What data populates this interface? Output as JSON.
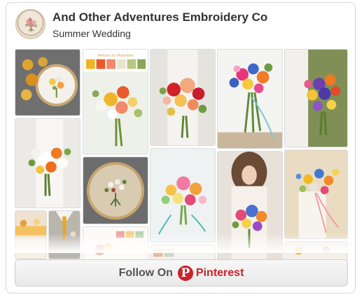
{
  "board": {
    "owner": "And Other Adventures Embroidery Co",
    "name": "Summer Wedding"
  },
  "pins": [
    {
      "name": "pin-embroidery-hoop-roses",
      "subject": "embroidery hoop with yellow roses"
    },
    {
      "name": "pin-petals-to-palettes",
      "subject": "bouquet colour palette",
      "caption": "Petals to Palettes"
    },
    {
      "name": "pin-red-peach-bouquet",
      "subject": "red and peach bouquet"
    },
    {
      "name": "pin-blue-pink-bouquet",
      "subject": "blue and pink bouquet with ribbons"
    },
    {
      "name": "pin-purple-orange-bouquet",
      "subject": "purple and orange bouquet"
    },
    {
      "name": "pin-orange-white-bouquet",
      "subject": "orange and white bouquet"
    },
    {
      "name": "pin-embroidery-hoop-bouquet",
      "subject": "embroidered bouquet in hoop"
    },
    {
      "name": "pin-pastel-bouquet-teal-ribbon",
      "subject": "bouquet with teal ribbon"
    },
    {
      "name": "pin-bride-bouquet",
      "subject": "bride holding bouquet"
    },
    {
      "name": "pin-wildflower-bouquet",
      "subject": "wildflower bouquet"
    },
    {
      "name": "pin-wedding-table",
      "subject": "wedding table setting"
    },
    {
      "name": "pin-groom-tie",
      "subject": "groom with orange tie"
    },
    {
      "name": "pin-pastel-palette",
      "subject": "pastel palette"
    },
    {
      "name": "pin-swatch-strip",
      "subject": "colour swatch strip"
    },
    {
      "name": "pin-flower-detail",
      "subject": "flower detail"
    }
  ],
  "follow_button": {
    "label": "Follow On",
    "brand": "Pinterest",
    "brand_icon": "pinterest-p-icon"
  },
  "colors": {
    "pinterest_red": "#c8232c",
    "title_text": "#333333",
    "button_text": "#555555"
  }
}
